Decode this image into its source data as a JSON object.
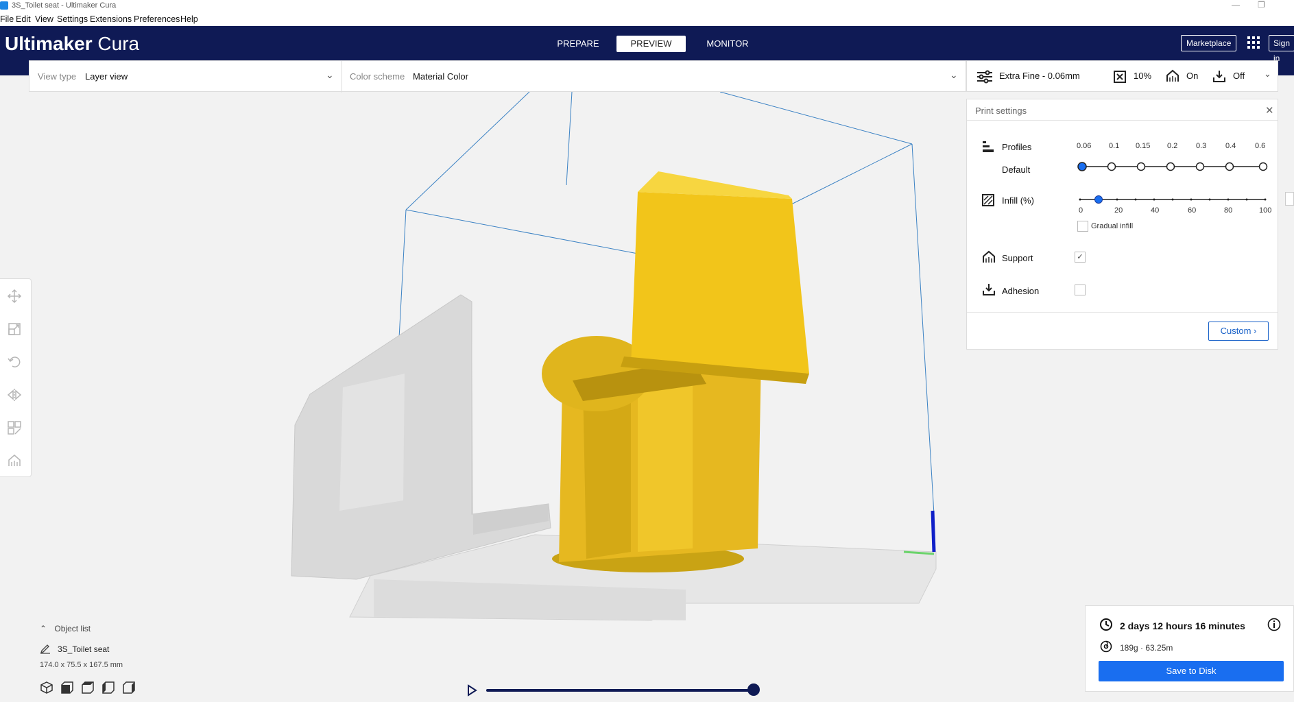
{
  "window": {
    "title": "3S_Toilet seat - Ultimaker Cura"
  },
  "menu": [
    "File",
    "Edit",
    "View",
    "Settings",
    "Extensions",
    "Preferences",
    "Help"
  ],
  "header": {
    "logo_bold": "Ultimaker",
    "logo_light": "Cura",
    "tabs": [
      "PREPARE",
      "PREVIEW",
      "MONITOR"
    ],
    "active_tab": "PREVIEW",
    "marketplace": "Marketplace",
    "sign_in": "Sign in"
  },
  "viewbar": {
    "view_type_label": "View type",
    "view_type_value": "Layer view",
    "color_scheme_label": "Color scheme",
    "color_scheme_value": "Material Color"
  },
  "print_summary": {
    "profile": "Extra Fine - 0.06mm",
    "infill": "10%",
    "support": "On",
    "adhesion": "Off"
  },
  "print_settings": {
    "title": "Print settings",
    "profiles_label": "Profiles",
    "default_label": "Default",
    "profile_values": [
      "0.06",
      "0.1",
      "0.15",
      "0.2",
      "0.3",
      "0.4",
      "0.6"
    ],
    "selected_profile": "0.06",
    "infill_label": "Infill (%)",
    "infill_ticks": [
      "0",
      "20",
      "40",
      "60",
      "80",
      "100"
    ],
    "infill_value": 10,
    "gradual_infill_label": "Gradual infill",
    "gradual_infill": false,
    "support_label": "Support",
    "support": true,
    "adhesion_label": "Adhesion",
    "adhesion": false,
    "custom_button": "Custom"
  },
  "object": {
    "list_label": "Object list",
    "name": "3S_Toilet seat",
    "dimensions": "174.0 x 75.5 x 167.5 mm"
  },
  "output": {
    "print_time": "2 days 12 hours 16 minutes",
    "material": "189g · 63.25m",
    "save_button": "Save to Disk"
  },
  "layer_slider": {
    "position": 1.0
  },
  "colors": {
    "header_bg": "#0f1a55",
    "accent": "#196ef0",
    "model": "#f2c51a"
  }
}
